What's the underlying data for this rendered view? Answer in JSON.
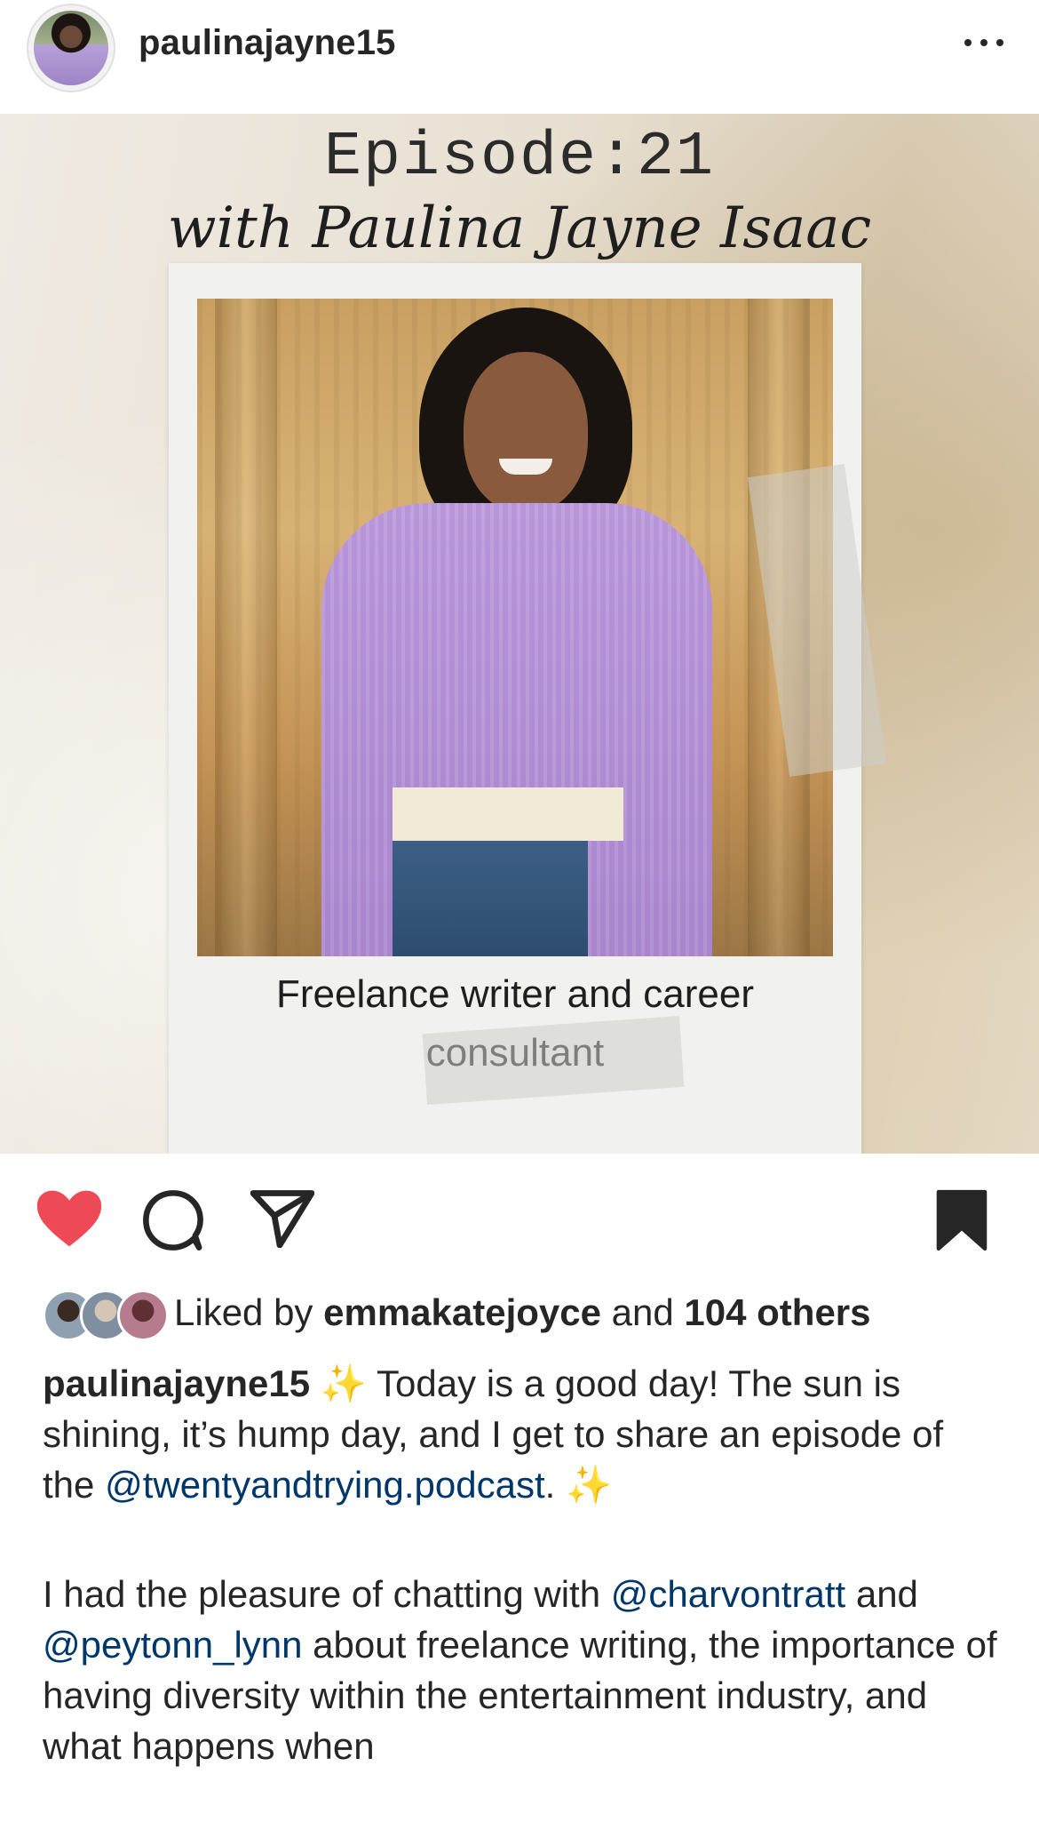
{
  "post": {
    "username": "paulinajayne15"
  },
  "image": {
    "episode_title": "Episode:21",
    "episode_sub": "with Paulina Jayne Isaac",
    "caption_line1": "Freelance writer and career",
    "caption_line2": "consultant"
  },
  "actions": {
    "liked": true,
    "bookmarked": true,
    "heart_color": "#ed4956"
  },
  "likes": {
    "prefix": "Liked by ",
    "user": "emmakatejoyce",
    "middle": " and ",
    "others": "104 others"
  },
  "caption": {
    "username": "paulinajayne15",
    "sparkle": "✨",
    "p1_text_a": " Today is a good day! The sun is shining, it’s hump day, and I get to share an episode of the ",
    "p1_mention": "@twentyandtrying.podcast",
    "p1_text_b": ". ",
    "p2_text_a": "I had the pleasure of chatting with ",
    "p2_mention1": "@charvontratt",
    "p2_text_b": " and ",
    "p2_mention2": "@peytonn_lynn",
    "p2_text_c": " about freelance writing, the importance of having diversity within the entertainment industry, and what happens when"
  },
  "colors": {
    "mention": "#00376b",
    "text": "#262626"
  }
}
